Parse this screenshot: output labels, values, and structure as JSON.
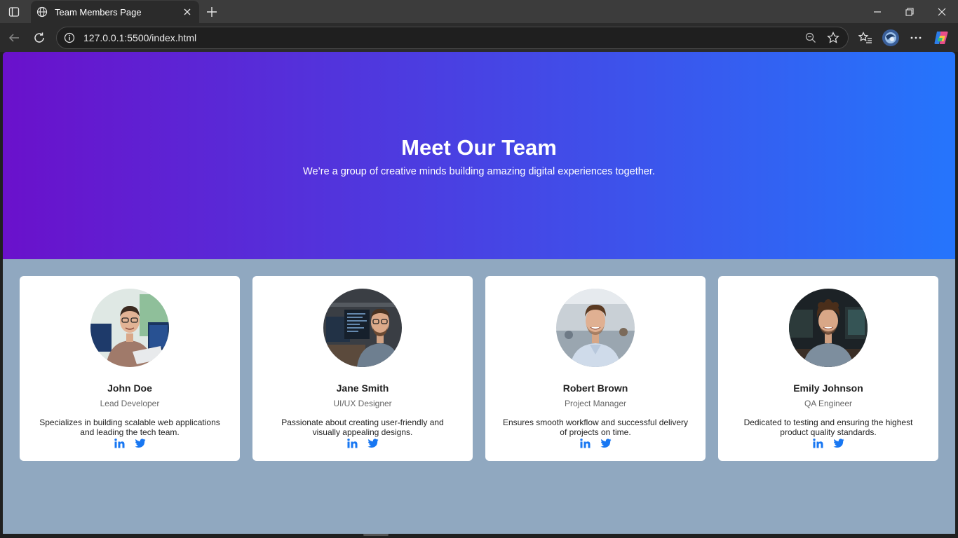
{
  "browser": {
    "tab_title": "Team Members Page",
    "url": "127.0.0.1:5500/index.html",
    "icons": [
      "sidebar-icon",
      "globe-icon",
      "close-icon",
      "plus-icon",
      "minimize-icon",
      "restore-icon",
      "window-close-icon",
      "back-icon",
      "refresh-icon",
      "info-icon",
      "zoom-out-icon",
      "star-icon",
      "favorites-icon",
      "profile-icon",
      "more-icon",
      "copilot-icon"
    ]
  },
  "hero": {
    "title": "Meet Our Team",
    "subtitle": "We’re a group of creative minds building amazing digital experiences together."
  },
  "team": [
    {
      "name": "John Doe",
      "role": "Lead Developer",
      "desc": "Specializes in building scalable web applications and leading the tech team."
    },
    {
      "name": "Jane Smith",
      "role": "UI/UX Designer",
      "desc": "Passionate about creating user-friendly and visually appealing designs."
    },
    {
      "name": "Robert Brown",
      "role": "Project Manager",
      "desc": "Ensures smooth workflow and successful delivery of projects on time."
    },
    {
      "name": "Emily Johnson",
      "role": "QA Engineer",
      "desc": "Dedicated to testing and ensuring the highest product quality standards."
    }
  ],
  "colors": {
    "hero_start": "#6a11cb",
    "hero_end": "#2575fc",
    "page_bg": "#90a8c0",
    "social": "#1877f2"
  }
}
